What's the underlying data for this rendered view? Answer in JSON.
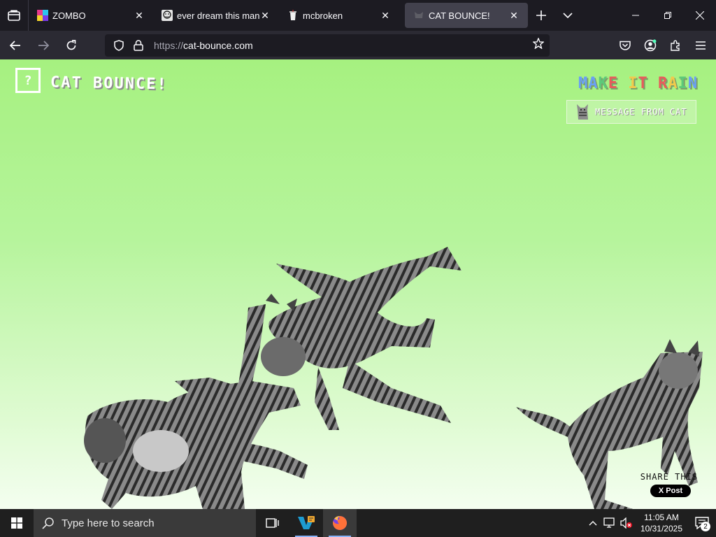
{
  "browser": {
    "tabs": [
      {
        "title": "ZOMBO",
        "favicon": "zombo-favicon",
        "active": false
      },
      {
        "title": "ever dream this man? –",
        "favicon": "face-favicon",
        "active": false
      },
      {
        "title": "mcbroken",
        "favicon": "cup-favicon",
        "active": false
      },
      {
        "title": "CAT BOUNCE!",
        "favicon": "cat-favicon",
        "active": true
      }
    ],
    "url_protocol": "https://",
    "url_host": "cat-bounce.com"
  },
  "page": {
    "help_label": "?",
    "logo": "CAT BOUNCE!",
    "rain_letters": [
      {
        "ch": "M",
        "color": "#6a9ff5"
      },
      {
        "ch": "A",
        "color": "#6a9ff5"
      },
      {
        "ch": "K",
        "color": "#5cc97a"
      },
      {
        "ch": "E",
        "color": "#e85b5b"
      },
      {
        "ch": " ",
        "color": "#ffffff"
      },
      {
        "ch": "I",
        "color": "#f2c94c"
      },
      {
        "ch": "T",
        "color": "#e85b5b"
      },
      {
        "ch": " ",
        "color": "#ffffff"
      },
      {
        "ch": "R",
        "color": "#e85b5b"
      },
      {
        "ch": "A",
        "color": "#f2c94c"
      },
      {
        "ch": "I",
        "color": "#5cc97a"
      },
      {
        "ch": "N",
        "color": "#6a9ff5"
      }
    ],
    "message_label": "MESSAGE FROM CAT",
    "share_label": "SHARE THIS",
    "post_label": "X Post"
  },
  "taskbar": {
    "search_placeholder": "Type here to search",
    "time": "11:05 AM",
    "date": "10/31/2025",
    "notification_count": "2"
  }
}
